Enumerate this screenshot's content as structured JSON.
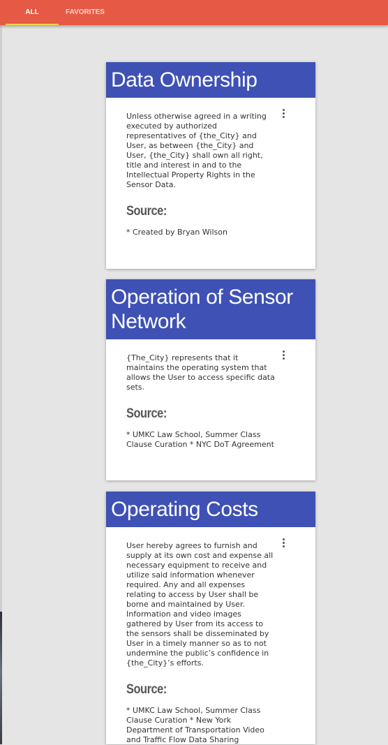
{
  "tabs": [
    {
      "label": "ALL"
    },
    {
      "label": "FAVORITES"
    }
  ],
  "cards": [
    {
      "title": "Data Ownership",
      "text": "Unless otherwise agreed in a writing executed by authorized representatives of {the_City} and User, as between {the_City} and User, {the_City} shall own all right, title and interest in and to the Intellectual Property Rights in the Sensor Data.",
      "source_label": "Source:",
      "source": "* Created by Bryan Wilson"
    },
    {
      "title": "Operation of Sensor Network",
      "text": "{The_City} represents that it maintains the operating system that allows the User to access specific data sets.",
      "source_label": "Source:",
      "source": "* UMKC Law School, Summer Class Clause Curation * NYC DoT Agreement"
    },
    {
      "title": "Operating Costs",
      "text": "User hereby agrees to furnish and supply at its own cost and expense all necessary equipment to receive and utilize said information whenever required. Any and all expenses relating to access by User shall be borne and maintained by User. Information and video images gathered by User from its access to the sensors shall be disseminated by User in a timely manner so as to not undermine the public’s confidence in {the_City}’s efforts.",
      "source_label": "Source:",
      "source": "* UMKC Law School, Summer Class Clause Curation * New York Department of Transportation Video and Traffic Flow Data Sharing"
    }
  ],
  "colors": {
    "topbar": "#e65a45",
    "card_header": "#3f51b5",
    "tab_indicator": "#f8d84a",
    "background": "#e5e5e5"
  },
  "icons": {
    "card_menu": "vertical-ellipsis-icon"
  }
}
